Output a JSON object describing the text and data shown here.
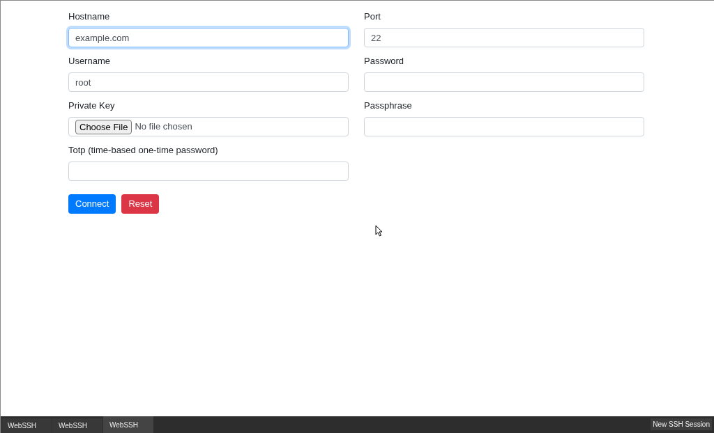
{
  "form": {
    "fields": [
      {
        "kind": "text",
        "label": "Hostname",
        "value": "example.com",
        "focused": true
      },
      {
        "kind": "text",
        "label": "Port",
        "value": "22",
        "focused": false
      },
      {
        "kind": "text",
        "label": "Username",
        "value": "root",
        "focused": false
      },
      {
        "kind": "text",
        "label": "Password",
        "focused": false
      },
      {
        "kind": "file",
        "label": "Private Key",
        "button": "Choose File",
        "status": "No file chosen",
        "focused": false
      },
      {
        "kind": "text",
        "label": "Passphrase",
        "focused": false
      },
      {
        "kind": "text",
        "label": "Totp (time-based one-time password)",
        "focused": false
      }
    ],
    "buttons": [
      {
        "kind": "primary",
        "label": "Connect"
      },
      {
        "kind": "danger",
        "label": "Reset"
      }
    ]
  },
  "taskbar": {
    "tasks": [
      {
        "label": "WebSSH",
        "selected": false
      },
      {
        "label": "WebSSH",
        "selected": false
      },
      {
        "label": "WebSSH",
        "selected": true
      }
    ],
    "action": "New SSH Session"
  }
}
